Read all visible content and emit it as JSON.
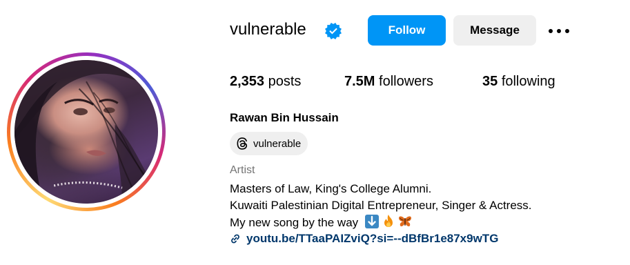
{
  "profile": {
    "username": "vulnerable",
    "full_name": "Rawan Bin Hussain",
    "verified_icon": "verified-badge-icon",
    "accent_color": "#0095f6"
  },
  "actions": {
    "follow_label": "Follow",
    "message_label": "Message",
    "more_icon": "more-options-icon"
  },
  "stats": {
    "posts_count": "2,353",
    "posts_label": "posts",
    "followers_count": "7.5M",
    "followers_label": "followers",
    "following_count": "35",
    "following_label": "following"
  },
  "threads_chip": {
    "label": "vulnerable",
    "icon": "threads-icon"
  },
  "bio": {
    "category": "Artist",
    "line1": "Masters of Law, King's College Alumni.",
    "line2": "Kuwaiti Palestinian Digital Entrepreneur, Singer & Actress.",
    "line3": "My new song by the way",
    "emojis": [
      "down-arrow-emoji",
      "fire-emoji",
      "butterfly-emoji"
    ]
  },
  "link": {
    "icon": "link-icon",
    "url_text": "youtu.be/TTaaPAIZviQ?si=--dBfBr1e87x9wTG"
  }
}
